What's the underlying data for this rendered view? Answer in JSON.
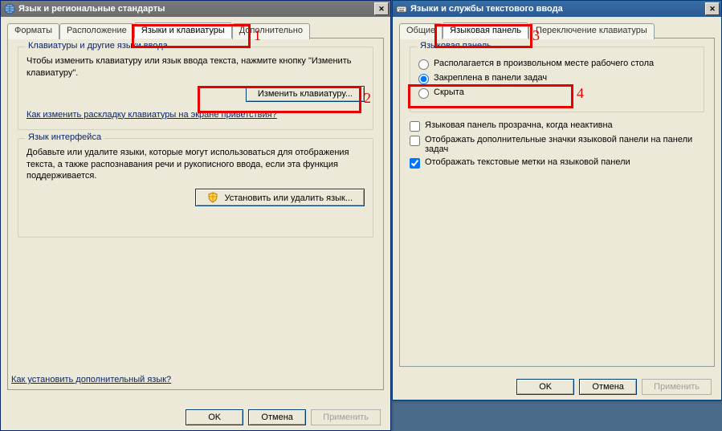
{
  "left": {
    "title": "Язык и региональные стандарты",
    "tabs": [
      "Форматы",
      "Расположение",
      "Языки и клавиатуры",
      "Дополнительно"
    ],
    "group1": {
      "legend": "Клавиатуры и другие языки ввода",
      "text": "Чтобы изменить клавиатуру или язык ввода текста, нажмите кнопку \"Изменить клавиатуру\".",
      "button": "Изменить клавиатуру...",
      "link": "Как изменить раскладку клавиатуры на экране приветствия?"
    },
    "group2": {
      "legend": "Язык интерфейса",
      "text": "Добавьте или удалите языки, которые могут использоваться для отображения текста, а также распознавания речи и рукописного ввода, если эта функция поддерживается.",
      "button": "Установить или удалить язык..."
    },
    "bottom_link": "Как установить дополнительный язык?",
    "ok": "OK",
    "cancel": "Отмена",
    "apply": "Применить"
  },
  "right": {
    "title": "Языки и службы текстового ввода",
    "tabs": [
      "Общие",
      "Языковая панель",
      "Переключение клавиатуры"
    ],
    "group": {
      "legend": "Языковая панель",
      "opt1": "Располагается в произвольном месте рабочего стола",
      "opt2": "Закреплена в панели задач",
      "opt3": "Скрыта"
    },
    "chk1": "Языковая панель прозрачна, когда неактивна",
    "chk2": "Отображать дополнительные значки языковой панели на панели задач",
    "chk3": "Отображать текстовые метки на языковой панели",
    "ok": "OK",
    "cancel": "Отмена",
    "apply": "Применить"
  },
  "annotations": {
    "n1": "1",
    "n2": "2",
    "n3": "3",
    "n4": "4"
  }
}
